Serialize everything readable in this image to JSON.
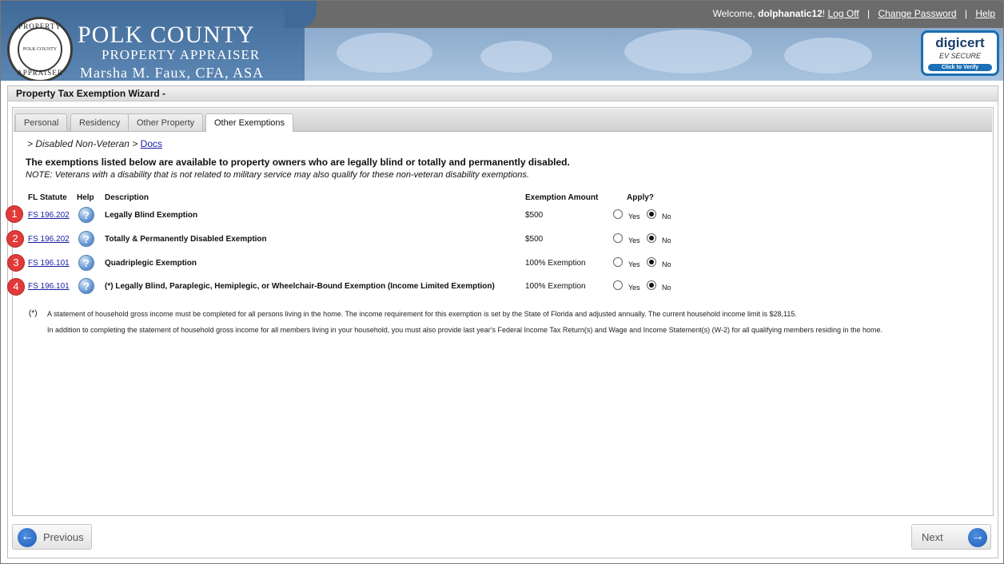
{
  "header": {
    "brand_title": "POLK COUNTY",
    "brand_subtitle": "PROPERTY APPRAISER",
    "brand_name": "Marsha M. Faux, CFA, ASA",
    "seal_top": "PROPERTY",
    "seal_bottom": "APPRAISER",
    "seal_center": "POLK COUNTY",
    "welcome_prefix": "Welcome, ",
    "username": "dolphanatic12",
    "welcome_suffix": "!",
    "logoff_label": "Log Off",
    "change_password_label": "Change Password",
    "help_label": "Help",
    "separator": "|",
    "digicert_name": "digicert",
    "digicert_ev": "EV SECURE",
    "digicert_verify": "Click to Verify"
  },
  "wizard": {
    "title": "Property Tax Exemption Wizard -",
    "tabs": [
      {
        "label": "Personal"
      },
      {
        "label": "Residency"
      },
      {
        "label": "Other Property"
      },
      {
        "label": "Other Exemptions"
      }
    ],
    "breadcrumb_prefix": ">  Disabled Non-Veteran  >",
    "breadcrumb_link": "Docs",
    "intro": "The exemptions listed below are available to property owners who are legally blind or totally and permanently disabled.",
    "note": "NOTE: Veterans with a disability that is not related to military service may also qualify for these non-veteran disability exemptions.",
    "columns": {
      "statute": "FL Statute",
      "help": "Help",
      "description": "Description",
      "amount": "Exemption Amount",
      "apply": "Apply?"
    },
    "rows": [
      {
        "marker": "1",
        "statute": "FS 196.202",
        "help_icon": "?",
        "description": "Legally Blind Exemption",
        "amount": "$500",
        "yes": "Yes",
        "no": "No",
        "selected": "No"
      },
      {
        "marker": "2",
        "statute": "FS 196.202",
        "help_icon": "?",
        "description": "Totally & Permanently Disabled Exemption",
        "amount": "$500",
        "yes": "Yes",
        "no": "No",
        "selected": "No"
      },
      {
        "marker": "3",
        "statute": "FS 196.101",
        "help_icon": "?",
        "description": "Quadriplegic Exemption",
        "amount": "100% Exemption",
        "yes": "Yes",
        "no": "No",
        "selected": "No"
      },
      {
        "marker": "4",
        "statute": "FS 196.101",
        "help_icon": "?",
        "description": "(*) Legally Blind, Paraplegic, Hemiplegic, or Wheelchair-Bound Exemption (Income Limited Exemption)",
        "amount": "100% Exemption",
        "yes": "Yes",
        "no": "No",
        "selected": "No"
      }
    ],
    "footnote_mark": "(*)",
    "footnote_1": "A statement of household gross income must be completed for all persons living in the home. The income requirement for this exemption is set by the State of Florida and adjusted annually. The current household income limit is $28,115.",
    "footnote_2": "In addition to completing the statement of household gross income for all members living in your household, you must also provide last year's Federal Income Tax Return(s) and Wage and Income Statement(s) (W-2) for all qualifying members residing in the home.",
    "previous_label": "Previous",
    "next_label": "Next"
  },
  "colors": {
    "header_blue": "#5c86b3",
    "link_blue": "#1a1aa6",
    "marker_red": "#e23a3a",
    "nav_button_blue": "#1d5cb5"
  },
  "icons": {
    "help": "question-mark-icon",
    "previous": "arrow-left-icon",
    "next": "arrow-right-icon"
  }
}
